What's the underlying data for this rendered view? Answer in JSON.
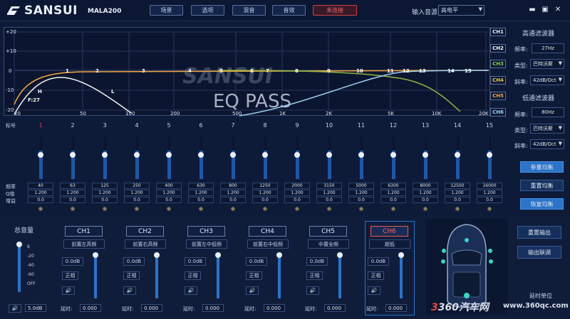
{
  "app": {
    "brand": "SANSUI",
    "model": "MALA200"
  },
  "toolbar": {
    "items": [
      "场景",
      "选项",
      "混音",
      "音效",
      "未连接"
    ]
  },
  "input_source": {
    "label": "输入音源",
    "value": "高电平"
  },
  "window_controls": [
    "minimize",
    "maximize",
    "close"
  ],
  "graph": {
    "watermark": "SANSUI",
    "overlay_text": "EQ PASS",
    "y_ticks": [
      "+20",
      "+10",
      "0",
      "-10",
      "-20"
    ],
    "x_ticks": [
      "20",
      "50",
      "100",
      "200",
      "500",
      "1K",
      "2K",
      "5K",
      "10K",
      "20K"
    ],
    "curve_labels": {
      "h": "H",
      "l": "L",
      "f": "F:27"
    },
    "channels": [
      {
        "label": "CH1",
        "color": "#e8ecf5"
      },
      {
        "label": "CH2",
        "color": "#ffffff"
      },
      {
        "label": "CH3",
        "color": "#7cd34a"
      },
      {
        "label": "CH4",
        "color": "#f2c43d"
      },
      {
        "label": "CH5",
        "color": "#ffa24a"
      },
      {
        "label": "CH6",
        "color": "#8fd7ff"
      }
    ],
    "colors": {
      "orange": "#f5a742",
      "green": "#8ab83f",
      "blue": "#9bd3f0",
      "white": "#f2f2f2",
      "yellow": "#e5c44a"
    }
  },
  "highpass": {
    "title": "高通滤波器",
    "freq_label": "频率:",
    "freq": "27Hz",
    "type_label": "类型:",
    "type": "巴特沃斯",
    "slope_label": "斜率:",
    "slope": "42dB/Oct"
  },
  "lowpass": {
    "title": "低通滤波器",
    "freq_label": "频率:",
    "freq": "80Hz",
    "type_label": "类型:",
    "type": "巴特沃斯",
    "slope_label": "斜率:",
    "slope": "42dB/Oct"
  },
  "eq_buttons": {
    "param": "参量均衡",
    "reset": "重置均衡",
    "restore": "恢复均衡"
  },
  "bands": {
    "header_label": "标号",
    "row_labels": [
      "频率",
      "Q值",
      "增益"
    ],
    "numbers": [
      "1",
      "2",
      "3",
      "4",
      "5",
      "6",
      "7",
      "8",
      "9",
      "10",
      "11",
      "12",
      "13",
      "14",
      "15"
    ],
    "freq": [
      "40",
      "63",
      "125",
      "250",
      "400",
      "630",
      "800",
      "1250",
      "2000",
      "3150",
      "5000",
      "6300",
      "8000",
      "12500",
      "16000"
    ],
    "q": [
      "1.200",
      "1.200",
      "1.200",
      "1.200",
      "1.200",
      "1.200",
      "1.200",
      "1.200",
      "1.200",
      "1.200",
      "1.200",
      "1.200",
      "1.200",
      "1.200",
      "1.200"
    ],
    "gain": [
      "0.0",
      "0.0",
      "0.0",
      "0.0",
      "0.0",
      "0.0",
      "0.0",
      "0.0",
      "0.0",
      "0.0",
      "0.0",
      "0.0",
      "0.0",
      "0.0",
      "0.0"
    ]
  },
  "master": {
    "title": "总音量",
    "scale": [
      "6",
      "-20",
      "-40",
      "-60",
      "OFF"
    ],
    "value": "5.0dB"
  },
  "channels": [
    {
      "name": "CH1",
      "position": "前置左高频",
      "level": "0.0dB",
      "phase": "正相",
      "delay_label": "延时:",
      "delay": "0.000"
    },
    {
      "name": "CH2",
      "position": "前置右高频",
      "level": "0.0dB",
      "phase": "正相",
      "delay_label": "延时:",
      "delay": "0.000"
    },
    {
      "name": "CH3",
      "position": "前置左中低频",
      "level": "0.0dB",
      "phase": "正相",
      "delay_label": "延时:",
      "delay": "0.000"
    },
    {
      "name": "CH4",
      "position": "前置右中低频",
      "level": "0.0dB",
      "phase": "正相",
      "delay_label": "延时:",
      "delay": "0.000"
    },
    {
      "name": "CH5",
      "position": "中置全频",
      "level": "0.0dB",
      "phase": "正相",
      "delay_label": "延时:",
      "delay": "0.000"
    },
    {
      "name": "CH6",
      "position": "超低",
      "level": "0.0dB",
      "phase": "正相",
      "delay_label": "延时:",
      "delay": "0.000"
    }
  ],
  "right_bottom": {
    "reset_output": "重置输出",
    "link_output": "输出联调",
    "delay_unit": "延时单位"
  },
  "watermark": {
    "site": "360汽车网",
    "url": "www.360qc.com"
  }
}
